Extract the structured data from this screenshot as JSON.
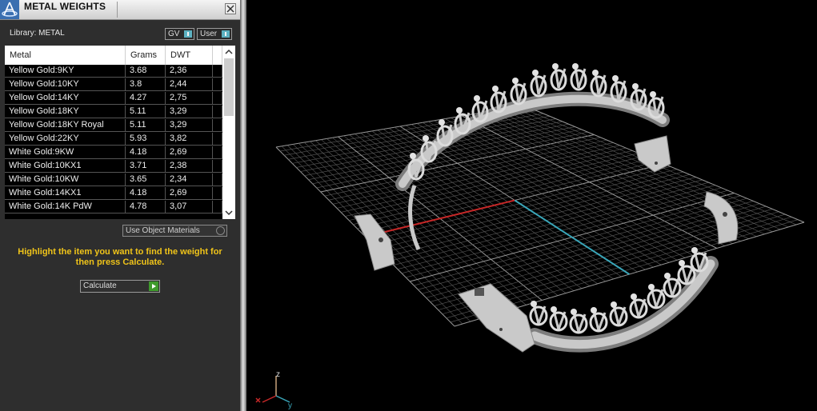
{
  "panel": {
    "title": "METAL WEIGHTS",
    "library_label": "Library: METAL",
    "toggles": [
      {
        "label": "GV"
      },
      {
        "label": "User"
      }
    ],
    "table": {
      "headers": [
        "Metal",
        "Grams",
        "DWT"
      ],
      "rows": [
        {
          "metal": "Yellow Gold:9KY",
          "grams": "3.68",
          "dwt": "2,36"
        },
        {
          "metal": "Yellow Gold:10KY",
          "grams": "3.8",
          "dwt": "2,44"
        },
        {
          "metal": "Yellow Gold:14KY",
          "grams": "4.27",
          "dwt": "2,75"
        },
        {
          "metal": "Yellow Gold:18KY",
          "grams": "5.11",
          "dwt": "3,29"
        },
        {
          "metal": "Yellow Gold:18KY Royal",
          "grams": "5.11",
          "dwt": "3,29"
        },
        {
          "metal": "Yellow Gold:22KY",
          "grams": "5.93",
          "dwt": "3,82"
        },
        {
          "metal": "White Gold:9KW",
          "grams": "4.18",
          "dwt": "2,69"
        },
        {
          "metal": "White Gold:10KX1",
          "grams": "3.71",
          "dwt": "2,38"
        },
        {
          "metal": "White Gold:10KW",
          "grams": "3.65",
          "dwt": "2,34"
        },
        {
          "metal": "White Gold:14KX1",
          "grams": "4.18",
          "dwt": "2,69"
        },
        {
          "metal": "White Gold:14K PdW",
          "grams": "4.78",
          "dwt": "3,07"
        }
      ]
    },
    "use_object_materials": "Use Object Materials",
    "instructions": "Highlight the item you want to find the weight for then press Calculate.",
    "calculate_label": "Calculate"
  },
  "viewport": {
    "axis_labels": {
      "z": "z",
      "y": "y"
    }
  },
  "colors": {
    "panel_bg": "#2e2e2e",
    "accent_teal": "#5cb1c1",
    "instruction_text": "#f0c419",
    "x_axis": "#c62828",
    "y_axis": "#3aa6b9",
    "go_green": "#3f9a2c"
  }
}
